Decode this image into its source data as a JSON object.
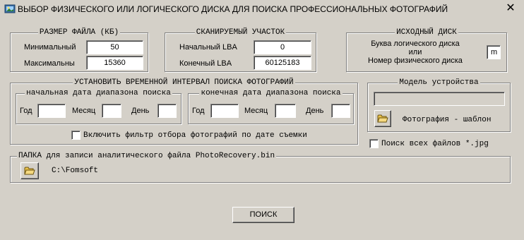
{
  "window": {
    "title": "ВЫБОР ФИЗИЧЕСКОГО ИЛИ ЛОГИЧЕСКОГО ДИСКА ДЛЯ ПОИСКА ПРОФЕССИОНАЛЬНЫХ ФОТОГРАФИЙ",
    "close_glyph": "✕"
  },
  "file_size": {
    "title": "РАЗМЕР ФАЙЛА (КБ)",
    "min_label": "Минимальный",
    "min_value": "50",
    "max_label": "Максимальны",
    "max_value": "15360"
  },
  "scan_area": {
    "title": "СКАНИРУЕМЫЙ УЧАСТОК",
    "start_label": "Начальный LBA",
    "start_value": "0",
    "end_label": "Конечный LBA",
    "end_value": "60125183"
  },
  "source_disk": {
    "title": "ИСХОДНЫЙ ДИСК",
    "line1": "Буква логического диска",
    "line2": "или",
    "line3": "Номер физического диска",
    "value": "m"
  },
  "date_interval": {
    "title": "УСТАНОВИТЬ ВРЕМЕННОЙ ИНТЕРВАЛ ПОИСКА ФОТОГРАФИЙ",
    "start": {
      "title": "начальная дата диапазона поиска",
      "year_label": "Год",
      "year_value": "",
      "month_label": "Месяц",
      "month_value": "",
      "day_label": "День",
      "day_value": ""
    },
    "end": {
      "title": "конечная дата диапазона поиска",
      "year_label": "Год",
      "year_value": "",
      "month_label": "Месяц",
      "month_value": "",
      "day_label": "День",
      "day_value": ""
    },
    "filter_label": "Включить фильтр отбора фотографий по дате съемки",
    "filter_checked": false
  },
  "device_model": {
    "title": "Модель устройства",
    "value": "",
    "template_label": "Фотография - шаблон"
  },
  "all_jpg": {
    "label": "Поиск всех файлов *.jpg",
    "checked": false
  },
  "output_folder": {
    "title": "ПАПКА для записи аналитического файла PhotoRecovery.bin",
    "path": "C:\\Fomsoft"
  },
  "search_button": {
    "label": "ПОИСК"
  },
  "icons": {
    "app": "photo-app-icon",
    "folder": "open-folder-icon",
    "close": "close-icon"
  },
  "colors": {
    "face": "#d4d0c8",
    "shadow": "#808080",
    "highlight": "#ffffff",
    "folder": "#e8c04a"
  }
}
